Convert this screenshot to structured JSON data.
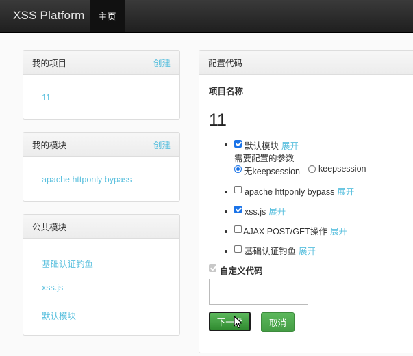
{
  "navbar": {
    "brand": "XSS Platform",
    "home_label": "主页"
  },
  "my_projects": {
    "title": "我的项目",
    "create_label": "创建",
    "items": [
      "11"
    ]
  },
  "my_modules": {
    "title": "我的模块",
    "create_label": "创建",
    "items": [
      "apache httponly bypass"
    ]
  },
  "public_modules": {
    "title": "公共模块",
    "items": [
      "基础认证钓鱼",
      "xss.js",
      "默认模块"
    ]
  },
  "config": {
    "title": "配置代码",
    "project_name_label": "项目名称",
    "project_name": "11",
    "expand_label": "展开",
    "default_module": {
      "label": "默认模块",
      "checked": true,
      "params_label": "需要配置的参数",
      "radio_options": [
        "无keepsession",
        "keepsession"
      ],
      "radio_selected": "无keepsession"
    },
    "modules": [
      {
        "label": "apache httponly bypass",
        "checked": false
      },
      {
        "label": "xss.js",
        "checked": true
      },
      {
        "label": "AJAX POST/GET操作",
        "checked": false
      },
      {
        "label": "基础认证钓鱼",
        "checked": false
      }
    ],
    "custom_code_label": "自定义代码",
    "custom_code_value": "",
    "next_button": "下一步",
    "cancel_button": "取消"
  },
  "colors": {
    "link": "#5bc0de",
    "button_green": "#5cb85c",
    "navbar": "#222222",
    "checkbox_blue": "#1a73e8"
  }
}
